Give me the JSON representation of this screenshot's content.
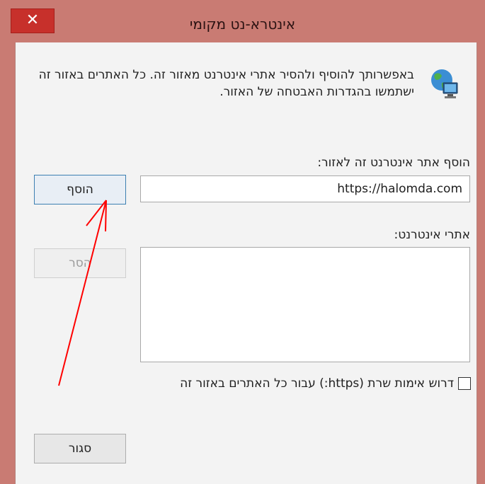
{
  "window": {
    "title": "אינטרא-נט מקומי",
    "close_glyph": "✕",
    "accent_color": "#c97b73",
    "close_color": "#c7302b"
  },
  "description": "באפשרותך להוסיף ולהסיר אתרי אינטרנט מאזור זה. כל האתרים באזור זה ישתמשו בהגדרות האבטחה של האזור.",
  "add_site": {
    "label": "הוסף אתר אינטרנט זה לאזור:",
    "value": "https://halomda.com",
    "button_label": "הוסף"
  },
  "sites": {
    "label": "אתרי אינטרנט:",
    "items": [],
    "remove_label": "הסר"
  },
  "require_https": {
    "label": "דרוש אימות שרת (https:) עבור כל האתרים באזור זה",
    "checked": false
  },
  "footer": {
    "close_label": "סגור"
  },
  "annotation": {
    "arrow_color": "#ff0000",
    "icon": "globe-computer-icon"
  }
}
